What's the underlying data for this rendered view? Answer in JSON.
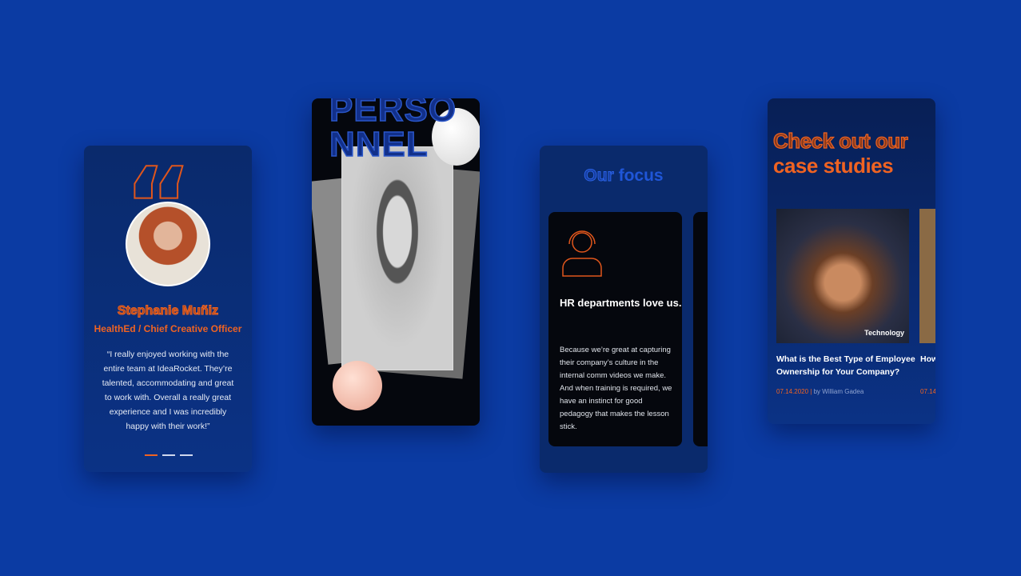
{
  "testimonial": {
    "name": "Stephanie Muñiz",
    "role": "HealthEd / Chief Creative Officer",
    "quote": "“I really enjoyed working with the entire team at IdeaRocket. They’re talented, accommodating and great to work with. Overall a really great experience and I was incredibly happy with their work!”",
    "active_slide": 1,
    "slides": 3
  },
  "personnel": {
    "heading": "PERSO NNEL"
  },
  "focus": {
    "title_outline": "Our",
    "title_bold": "focus",
    "card_title": "HR departments love us.",
    "card_text": "Because we’re great at capturing their company’s culture in the internal comm videos we make. And when training is required, we have an instinct for good pedagogy that makes the lesson stick."
  },
  "cases": {
    "title_line1": "Check out our",
    "title_line2": "case studies",
    "articles": [
      {
        "tag": "Technology",
        "title": "What is the Best Type of Employee Ownership for Your Company?",
        "date": "07.14.2020",
        "author": "by William Gadea"
      },
      {
        "title": "How Cha",
        "date": "07.14"
      }
    ]
  },
  "colors": {
    "background": "#0b3ba3",
    "accent": "#ef6322",
    "card": "#0a2a6c"
  }
}
